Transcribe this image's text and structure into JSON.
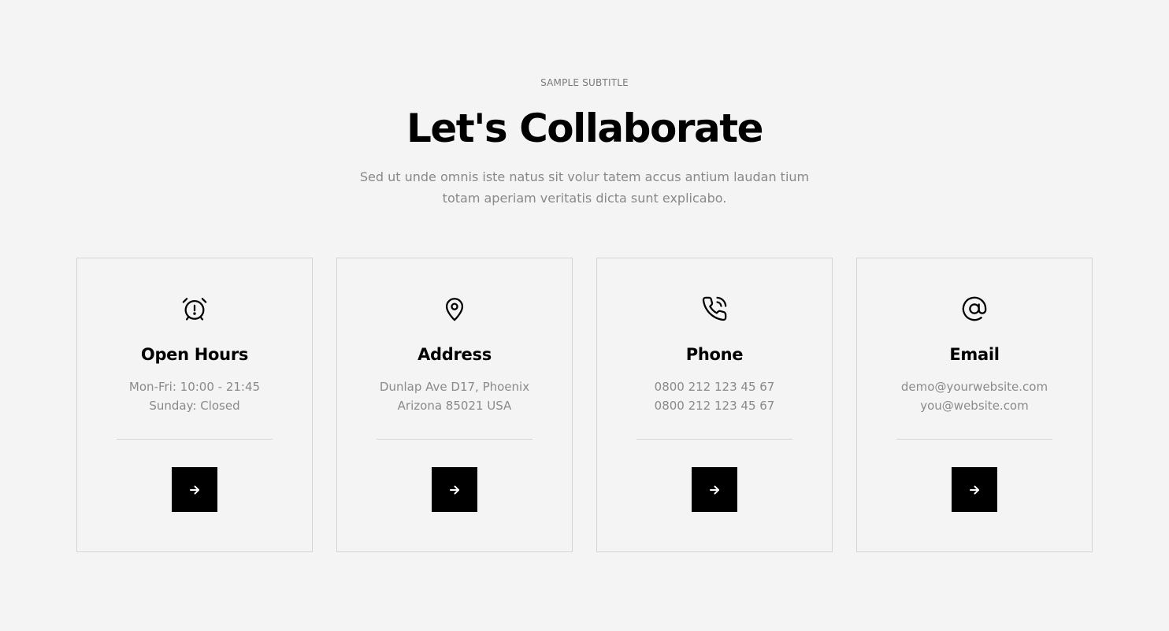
{
  "header": {
    "subtitle": "SAMPLE SUBTITLE",
    "title": "Let's Collaborate",
    "lead": "Sed ut unde omnis iste natus sit volur tatem accus antium laudan tium totam aperiam veritatis dicta sunt explicabo."
  },
  "cards": [
    {
      "icon": "alarm-clock-icon",
      "title": "Open Hours",
      "line1": "Mon-Fri: 10:00 - 21:45",
      "line2": "Sunday: Closed"
    },
    {
      "icon": "map-pin-icon",
      "title": "Address",
      "line1": "Dunlap Ave D17, Phoenix",
      "line2": "Arizona 85021 USA"
    },
    {
      "icon": "phone-call-icon",
      "title": "Phone",
      "line1": "0800 212 123 45 67",
      "line2": "0800 212 123 45 67"
    },
    {
      "icon": "at-sign-icon",
      "title": "Email",
      "line1": "demo@yourwebsite.com",
      "line2": "you@website.com"
    }
  ],
  "colors": {
    "background": "#f4f4f4",
    "button": "#000000",
    "muted_text": "#8a8a8a",
    "border": "#d4d4d4"
  }
}
